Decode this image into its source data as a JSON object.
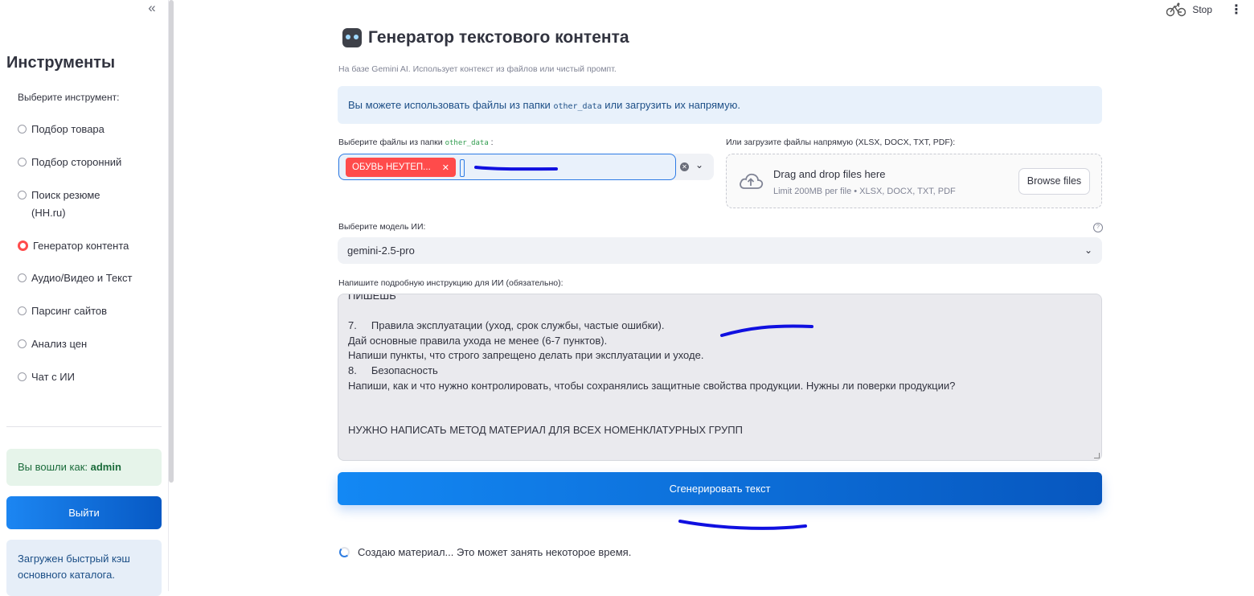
{
  "sidebar": {
    "collapse_icon": "«",
    "title": "Инструменты",
    "prompt": "Выберите инструмент:",
    "tools": [
      {
        "label": "Подбор товара",
        "selected": false
      },
      {
        "label": "Подбор сторонний",
        "selected": false
      },
      {
        "label": "Поиск резюме (HH.ru)",
        "selected": false
      },
      {
        "label": "Генератор контента",
        "selected": true
      },
      {
        "label": "Аудио/Видео и Текст",
        "selected": false
      },
      {
        "label": "Парсинг сайтов",
        "selected": false
      },
      {
        "label": "Анализ цен",
        "selected": false
      },
      {
        "label": "Чат с ИИ",
        "selected": false
      }
    ],
    "login_prefix": "Вы вошли как:",
    "login_user": "admin",
    "logout_label": "Выйти",
    "cache_message": "Загружен быстрый кэш основного каталога."
  },
  "topbar": {
    "stop_label": "Stop",
    "running_icon": "bicycle-icon",
    "menu_icon": "⋮"
  },
  "main": {
    "title": "Генератор текстового контента",
    "subtitle": "На базе Gemini AI. Использует контекст из файлов или чистый промпт.",
    "info_prefix": "Вы можете использовать файлы из папки",
    "info_code": "other_data",
    "info_suffix": "или загрузить их напрямую.",
    "files_label_prefix": "Выберите файлы из папки",
    "files_label_code": "other_data",
    "files_label_suffix": ":",
    "selected_tag": "ОБУВЬ НЕУТЕП...",
    "upload_label": "Или загрузите файлы напрямую (XLSX, DOCX, TXT, PDF):",
    "upload_title": "Drag and drop files here",
    "upload_limit": "Limit 200MB per file • XLSX, DOCX, TXT, PDF",
    "browse_label": "Browse files",
    "model_label": "Выберите модель ИИ:",
    "model_value": "gemini-2.5-pro",
    "instruction_label": "Напишите подробную инструкцию для ИИ (обязательно):",
    "instruction_lines": [
      "ПИШЕШЬ",
      "",
      "7.     Правила эксплуатации (уход, срок службы, частые ошибки).",
      "Дай основные правила ухода не менее (6-7 пунктов).",
      "Напиши пункты, что строго запрещено делать при эксплуатации и уходе.",
      "8.     Безопасность",
      "Напиши, как и что нужно контролировать, чтобы сохранялись защитные свойства продукции. Нужны ли поверки продукции?",
      "",
      "",
      "НУЖНО НАПИСАТЬ МЕТОД МАТЕРИАЛ ДЛЯ ВСЕХ НОМЕНКЛАТУРНЫХ ГРУПП"
    ],
    "generate_label": "Сгенерировать текст",
    "status_text": "Создаю материал... Это может занять некоторое время."
  },
  "colors": {
    "accent": "#ff4b4b",
    "primary_button": "#0b6fe0",
    "scribble": "#1010e0"
  }
}
